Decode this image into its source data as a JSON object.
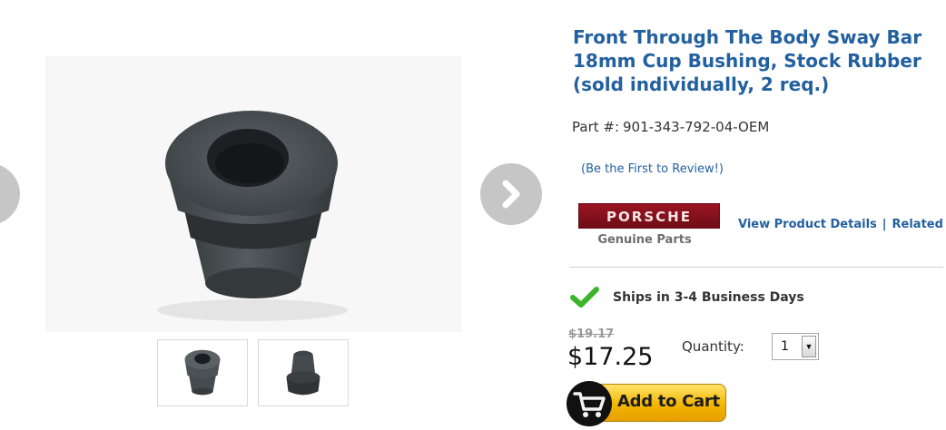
{
  "product": {
    "title": "Front Through The Body Sway Bar 18mm Cup Bushing, Stock Rubber (sold individually, 2 req.)",
    "part_label": "Part #:",
    "part_number": "901-343-792-04-OEM",
    "review_link": "(Be the First to Review!)"
  },
  "brand": {
    "logo_text": "PORSCHE",
    "sub_text": "Genuine Parts",
    "colors": {
      "bar": "#8a1220",
      "sub_text": "#6e6e6e"
    }
  },
  "links": {
    "view_details": "View Product Details",
    "separator": "|",
    "related": "Related Pr"
  },
  "shipping": {
    "icon": "checkmark-icon",
    "text": "Ships in 3-4 Business Days",
    "icon_color": "#3cb52d"
  },
  "pricing": {
    "old_price": "$19.17",
    "price": "$17.25"
  },
  "quantity": {
    "label": "Quantity:",
    "value": "1"
  },
  "cart": {
    "button_label": "Add to Cart",
    "icon": "cart-icon",
    "button_color": "#f3b600"
  },
  "gallery": {
    "prev_icon": "chevron-left-icon",
    "next_icon": "chevron-right-icon",
    "thumbnail_count": 2
  },
  "theme": {
    "link_color": "#23609f",
    "divider_color": "#d3d3d3"
  }
}
